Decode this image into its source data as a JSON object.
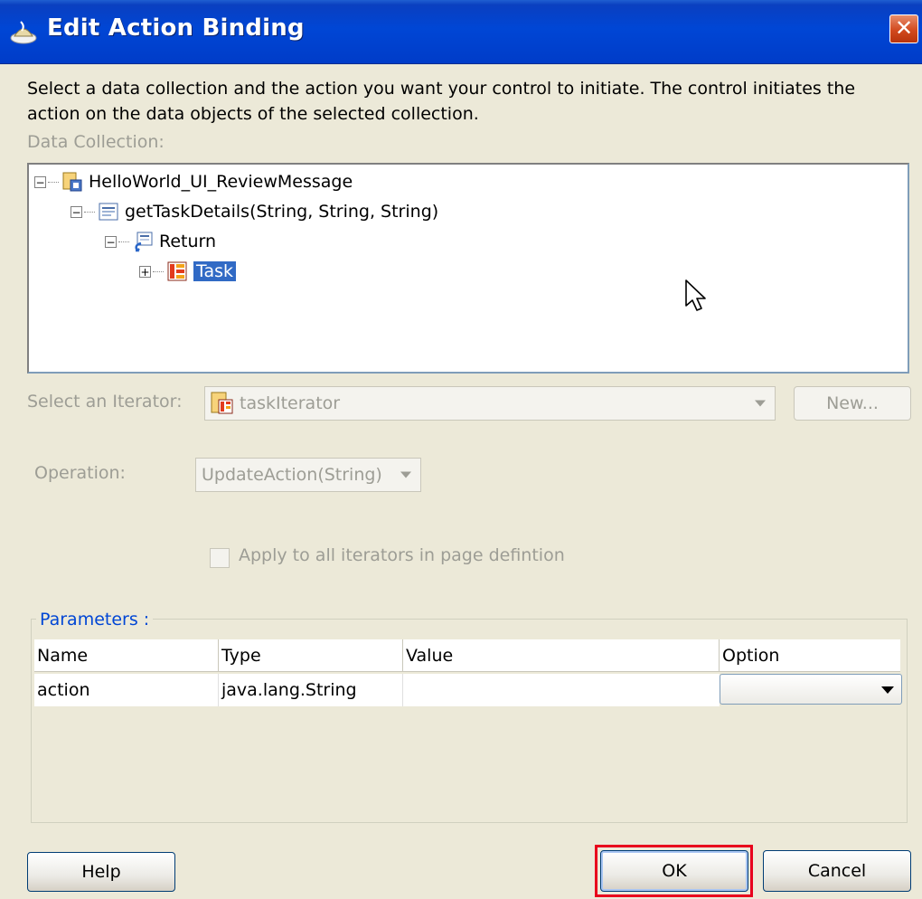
{
  "window": {
    "title": "Edit Action Binding",
    "close_glyph": "✕"
  },
  "description": "Select a data collection and the action you want your control to initiate. The control initiates the action on the data objects of the selected collection.",
  "data_collection": {
    "label": "Data Collection:",
    "tree": [
      {
        "label": "HelloWorld_UI_ReviewMessage",
        "icon": "data-control-icon",
        "expanded": true
      },
      {
        "label": "getTaskDetails(String, String, String)",
        "icon": "method-icon",
        "expanded": true
      },
      {
        "label": "Return",
        "icon": "return-icon",
        "expanded": true
      },
      {
        "label": "Task",
        "icon": "collection-icon",
        "expanded": false,
        "selected": true
      }
    ]
  },
  "iterator": {
    "label": "Select an Iterator:",
    "value": "taskIterator",
    "new_button": "New..."
  },
  "operation": {
    "label": "Operation:",
    "value": "UpdateAction(String)"
  },
  "apply_all": {
    "label": "Apply to all iterators in page defintion",
    "checked": false
  },
  "parameters": {
    "legend": "Parameters :",
    "columns": [
      "Name",
      "Type",
      "Value",
      "Option"
    ],
    "rows": [
      {
        "name": "action",
        "type": "java.lang.String",
        "value": "",
        "option": ""
      }
    ]
  },
  "buttons": {
    "help": "Help",
    "ok": "OK",
    "cancel": "Cancel"
  },
  "colors": {
    "title_bar": "#0046d5",
    "selection": "#316ac5",
    "highlight_box": "#e8001c"
  }
}
